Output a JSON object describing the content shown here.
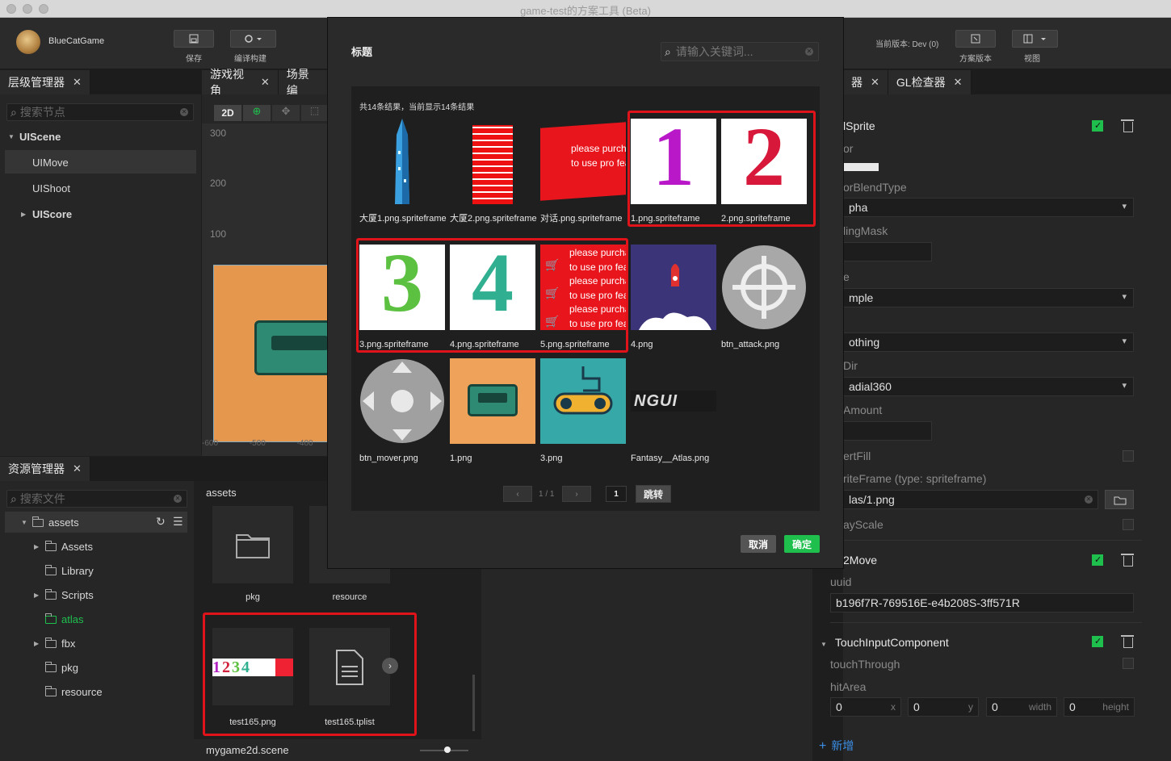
{
  "window": {
    "title": "game-test的方案工具 (Beta)"
  },
  "toolbar": {
    "user": "BlueCatGame",
    "save_label": "保存",
    "build_label": "编译构建",
    "version_text": "当前版本: Dev (0)",
    "scheme_label": "方案版本",
    "view_label": "视图"
  },
  "hierarchy": {
    "tab": "层级管理器",
    "search_placeholder": "搜索节点",
    "root": "UIScene",
    "items": [
      "UIMove",
      "UIShoot",
      "UIScore"
    ]
  },
  "scene": {
    "tabs": [
      "游戏视角",
      "场景编"
    ],
    "mode_2d": "2D",
    "ruler": [
      "300",
      "200",
      "100"
    ],
    "bottom_ruler": [
      "-600",
      "-500",
      "-400"
    ]
  },
  "assets_panel": {
    "tab": "资源管理器",
    "search_placeholder": "搜索文件",
    "root": "assets",
    "tree": [
      "Assets",
      "Library",
      "Scripts",
      "atlas",
      "fbx",
      "pkg",
      "resource"
    ],
    "breadcrumb": "assets",
    "grid": [
      "pkg",
      "resource",
      "test165.png",
      "test165.tplist"
    ],
    "footer": "mygame2d.scene"
  },
  "inspector": {
    "tabs": [
      "器",
      "GL检查器"
    ],
    "component_title": "lSprite",
    "labels": [
      "or",
      "orBlendType",
      "lingMask",
      "e",
      "",
      "Dir",
      "Amount",
      "ertFill",
      "riteFrame (type: spriteframe)",
      "ayScale"
    ],
    "blend_value": "pha",
    "type_value": "mple",
    "fill_value": "othing",
    "dir_value": "adial360",
    "frame_value": "las/1.png",
    "move_title": "2Move",
    "uuid_label": "uuid",
    "uuid_value": "b196f7R-769516E-e4b208S-3ff571R",
    "touch_title": "TouchInputComponent",
    "touch_through": "touchThrough",
    "hit_area": "hitArea",
    "hit_fields": [
      {
        "value": "0",
        "unit": "x"
      },
      {
        "value": "0",
        "unit": "y"
      },
      {
        "value": "0",
        "unit": "width"
      },
      {
        "value": "0",
        "unit": "height"
      }
    ],
    "add_label": "新增"
  },
  "modal": {
    "title": "标题",
    "search_placeholder": "请输入关键词...",
    "result_text": "共14条结果，当前显示14条结果",
    "items": [
      "大厦1.png.spriteframe",
      "大厦2.png.spriteframe",
      "对话.png.spriteframe",
      "1.png.spriteframe",
      "2.png.spriteframe",
      "3.png.spriteframe",
      "4.png.spriteframe",
      "5.png.spriteframe",
      "4.png",
      "btn_attack.png",
      "btn_mover.png",
      "1.png",
      "3.png",
      "Fantasy__Atlas.png"
    ],
    "promo_text": [
      "please purcha",
      "to use pro fea"
    ],
    "page_text": "1 / 1",
    "page_input": "1",
    "jump_label": "跳转",
    "cancel_label": "取消",
    "ok_label": "确定",
    "ngui_text": "NGUI",
    "colors": {
      "ok": "#1fbf4e",
      "highlight": "#e0131b"
    }
  }
}
